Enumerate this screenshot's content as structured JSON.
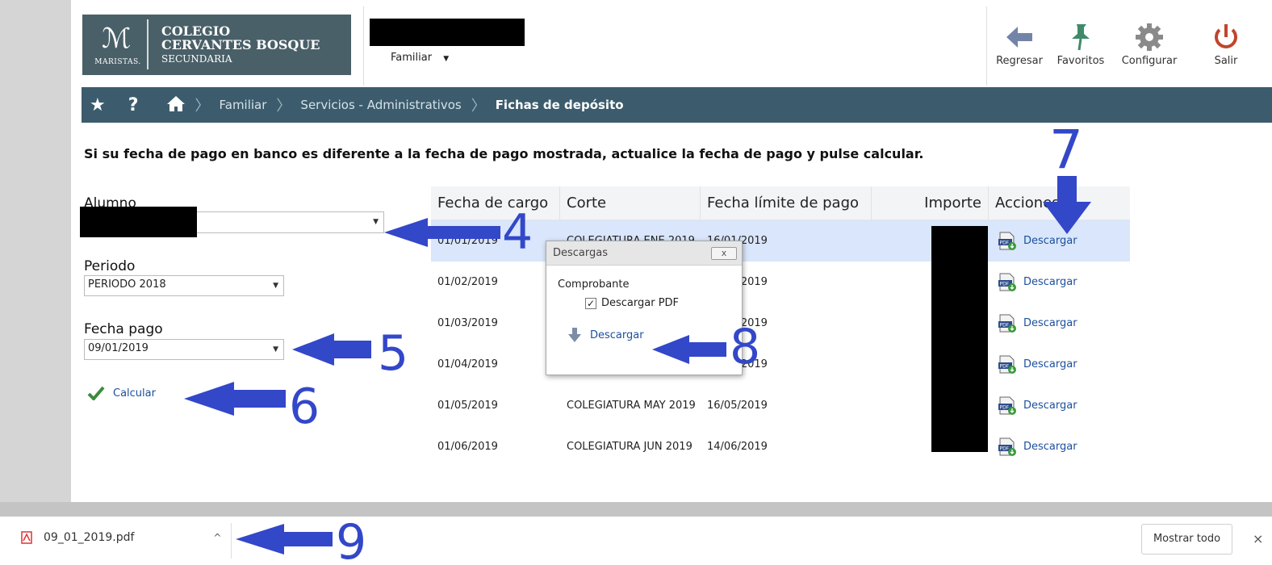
{
  "header": {
    "logo": {
      "crest_brand": "MARISTAS.",
      "name_line1": "COLEGIO",
      "name_line2": "CERVANTES BOSQUE",
      "name_line3": "SECUNDARIA"
    },
    "user_menu_label": "Familiar",
    "toolbar": {
      "back_label": "Regresar",
      "favorites_label": "Favoritos",
      "settings_label": "Configurar",
      "logout_label": "Salir"
    }
  },
  "breadcrumb": {
    "items": [
      "Familiar",
      "Servicios - Administrativos"
    ],
    "current": "Fichas de depósito"
  },
  "instruction": "Si su fecha de pago en banco es diferente a la fecha de pago mostrada, actualice la fecha de pago y pulse calcular.",
  "form": {
    "alumno_label": "Alumno",
    "periodo_label": "Periodo",
    "periodo_value": "PERIODO 2018",
    "fecha_pago_label": "Fecha pago",
    "fecha_pago_value": "09/01/2019",
    "calcular_label": "Calcular"
  },
  "table": {
    "headers": [
      "Fecha de cargo",
      "Corte",
      "Fecha límite de pago",
      "Importe",
      "Acciones"
    ],
    "action_label": "Descargar",
    "rows": [
      {
        "fecha_cargo": "01/01/2019",
        "corte": "COLEGIATURA ENE 2019",
        "fecha_limite": "16/01/2019"
      },
      {
        "fecha_cargo": "01/02/2019",
        "corte": "",
        "fecha_limite": "15/02/2019"
      },
      {
        "fecha_cargo": "01/03/2019",
        "corte": "",
        "fecha_limite": "15/03/2019"
      },
      {
        "fecha_cargo": "01/04/2019",
        "corte": "",
        "fecha_limite": "16/04/2019"
      },
      {
        "fecha_cargo": "01/05/2019",
        "corte": "COLEGIATURA MAY 2019",
        "fecha_limite": "16/05/2019"
      },
      {
        "fecha_cargo": "01/06/2019",
        "corte": "COLEGIATURA JUN 2019",
        "fecha_limite": "14/06/2019"
      }
    ]
  },
  "dialog": {
    "title": "Descargas",
    "close_label": "x",
    "section": "Comprobante",
    "checkbox_label": "Descargar PDF",
    "checkbox_checked": true,
    "download_label": "Descargar"
  },
  "annotations": {
    "n4": "4",
    "n5": "5",
    "n6": "6",
    "n7": "7",
    "n8": "8",
    "n9": "9",
    "color": "#3347c9"
  },
  "download_bar": {
    "file_name": "09_01_2019.pdf",
    "show_all_label": "Mostrar todo",
    "close_label": "×"
  },
  "colors": {
    "breadcrumb_bg": "#3c5c6d",
    "logo_bg": "#4a6068",
    "link": "#1c4f9c",
    "selected_row": "#d9e6fb"
  }
}
